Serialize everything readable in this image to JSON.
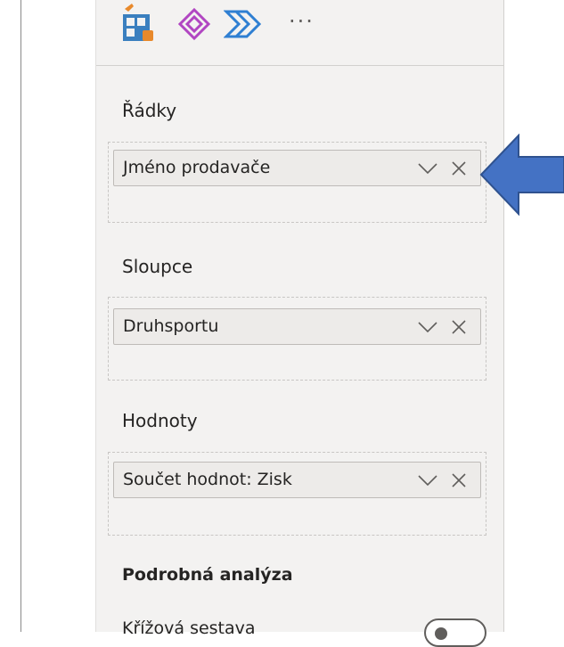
{
  "toolbar": {
    "more_label": "···"
  },
  "wells": {
    "rows": {
      "label": "Řádky",
      "field": "Jméno prodavače"
    },
    "columns": {
      "label": "Sloupce",
      "field": "Druhsportu"
    },
    "values": {
      "label": "Hodnoty",
      "field": "Součet hodnot: Zisk"
    }
  },
  "drill": {
    "title": "Podrobná analýza",
    "cross_report_label": "Křížová sestava"
  },
  "colors": {
    "accent_arrow": "#4472c4",
    "pane_bg": "#f3f2f1",
    "pill_bg": "#edebe9"
  }
}
